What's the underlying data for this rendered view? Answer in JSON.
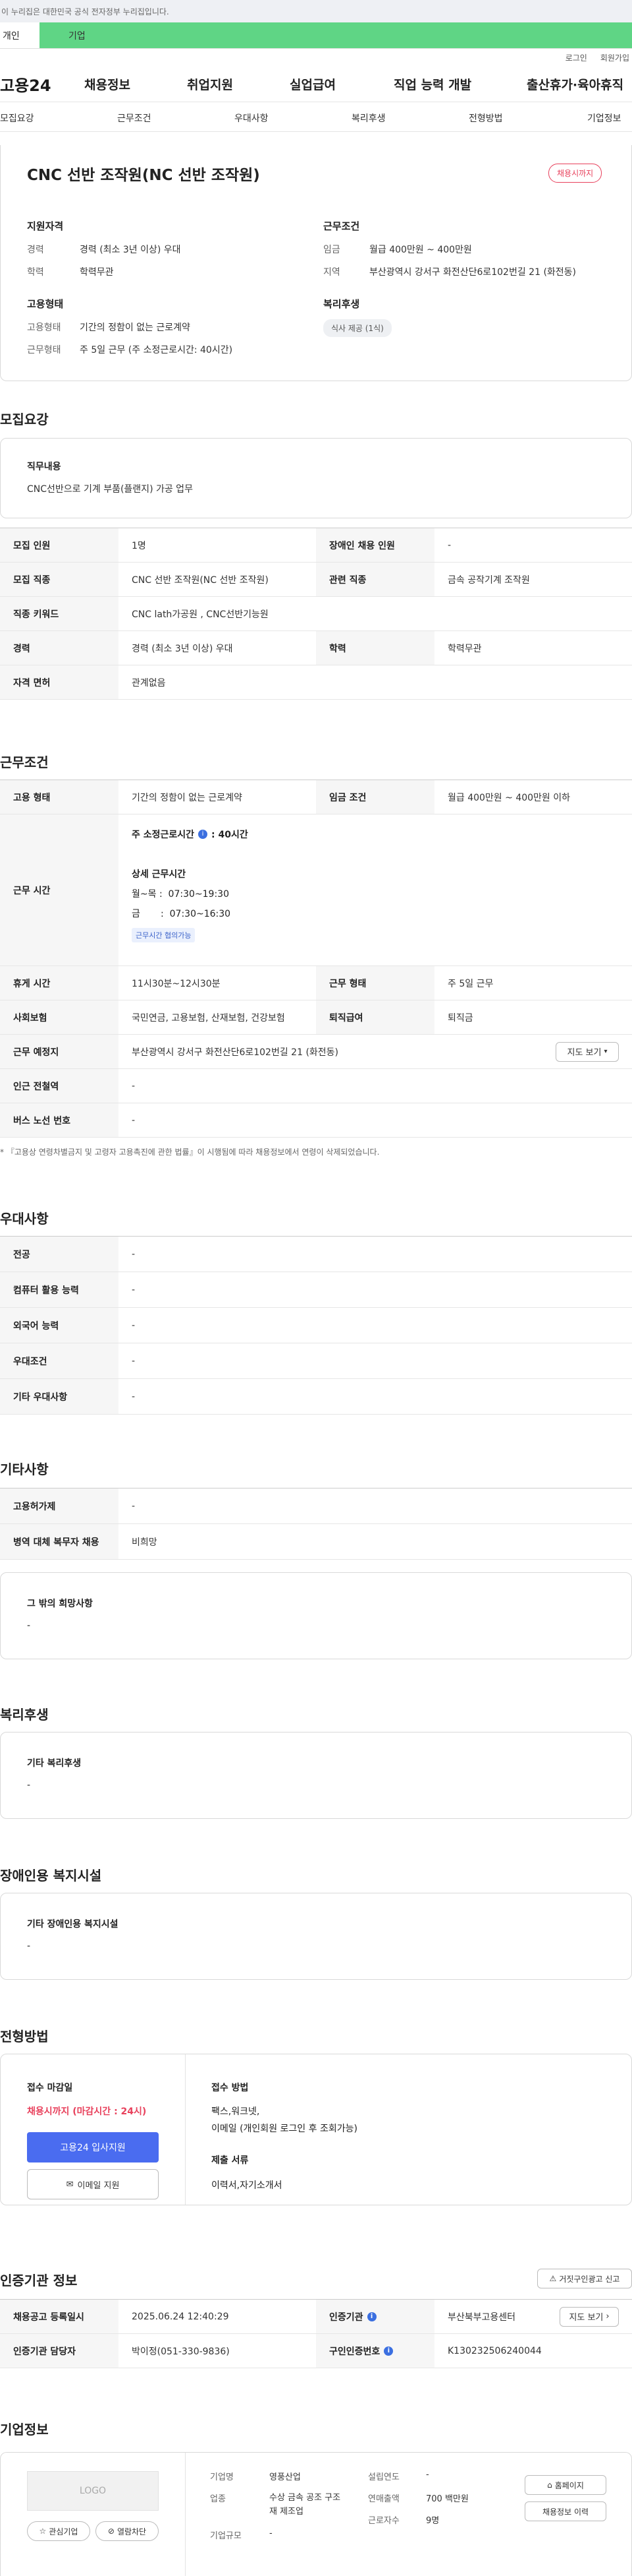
{
  "gov_notice": "이 누리집은 대한민국 공식 전자정부 누리집입니다.",
  "tabs": [
    "개인",
    "기업"
  ],
  "util": [
    "로그인",
    "회원가입"
  ],
  "logo": "고용24",
  "gnb": [
    "채용정보",
    "취업지원",
    "실업급여",
    "직업 능력 개발",
    "출산휴가·육아휴직"
  ],
  "subnav": [
    "모집요강",
    "근무조건",
    "우대사항",
    "복리후생",
    "전형방법",
    "기업정보"
  ],
  "summary": {
    "title": "CNC 선반 조작원(NC 선반 조작원)",
    "badge": "채용시까지",
    "qual_head": "지원자격",
    "cond_head": "근무조건",
    "emp_head": "고용형태",
    "welfare_head": "복리후생",
    "qual": [
      [
        "경력",
        "경력 (최소 3년 이상) 우대"
      ],
      [
        "학력",
        "학력무관"
      ]
    ],
    "cond": [
      [
        "임금",
        "월급 400만원 ~ 400만원"
      ],
      [
        "지역",
        "부산광역시 강서구 화전산단6로102번길 21 (화전동)"
      ]
    ],
    "emp": [
      [
        "고용형태",
        "기간의 정함이 없는 근로계약"
      ],
      [
        "근무형태",
        "주 5일 근무 (주 소정근로시간: 40시간)"
      ]
    ],
    "welfare_tag": "식사 제공 (1식)"
  },
  "s1": {
    "title": "모집요강",
    "duty_label": "직무내용",
    "duty": "CNC선반으로 기계 부품(플랜지) 가공 업무",
    "rows": [
      {
        "th1": "모집 인원",
        "td1": "1명",
        "th2": "장애인 채용 인원",
        "td2": "-"
      },
      {
        "th1": "모집 직종",
        "td1": "CNC 선반 조작원(NC 선반 조작원)",
        "th2": "관련 직종",
        "td2": "금속 공작기계 조작원"
      },
      {
        "th1": "직종 키워드",
        "td1": "CNC lath가공원 , CNC선반기능원"
      },
      {
        "th1": "경력",
        "td1": "경력 (최소 3년 이상) 우대",
        "th2": "학력",
        "td2": "학력무관"
      },
      {
        "th1": "자격 면허",
        "td1": "관계없음"
      }
    ]
  },
  "s2": {
    "title": "근무조건",
    "row1": {
      "th1": "고용 형태",
      "td1": "기간의 정함이 없는 근로계약",
      "th2": "임금 조건",
      "td2": "월급 400만원 ~ 400만원 이하"
    },
    "worktime": {
      "th": "근무 시간",
      "weekly": "주 소정근로시간",
      "weekly_val": ": 40시간",
      "detail": "상세 근무시간",
      "l1": "월~목 :  07:30~19:30",
      "l2": "금       :  07:30~16:30",
      "tag": "근무시간 협의가능"
    },
    "rows": [
      {
        "th1": "휴게 시간",
        "td1": "11시30분~12시30분",
        "th2": "근무 형태",
        "td2": "주 5일 근무"
      },
      {
        "th1": "사회보험",
        "td1": "국민연금, 고용보험, 산재보험, 건강보험",
        "th2": "퇴직급여",
        "td2": "퇴직금"
      }
    ],
    "place": {
      "th": "근무 예정지",
      "td": "부산광역시 강서구 화전산단6로102번길 21 (화전동)",
      "btn": "지도 보기"
    },
    "rows2": [
      {
        "th": "인근 전철역",
        "td": "-"
      },
      {
        "th": "버스 노선 번호",
        "td": "-"
      }
    ],
    "note": "* 『고용상 연령차별금지 및 고령자 고용촉진에 관한 법률』이 시행됨에 따라 채용정보에서 연령이 삭제되었습니다."
  },
  "s3": {
    "title": "우대사항",
    "rows": [
      [
        "전공",
        "-"
      ],
      [
        "컴퓨터 활용 능력",
        "-"
      ],
      [
        "외국어 능력",
        "-"
      ],
      [
        "우대조건",
        "-"
      ],
      [
        "기타 우대사항",
        "-"
      ]
    ]
  },
  "s4": {
    "title": "기타사항",
    "rows": [
      [
        "고용허가제",
        "-"
      ],
      [
        "병역 대체 복무자 채용",
        "비희망"
      ]
    ],
    "other_label": "그 밖의 희망사항",
    "other_val": "-"
  },
  "s5": {
    "title": "복리후생",
    "label": "기타 복리후생",
    "val": "-"
  },
  "s6": {
    "title": "장애인용 복지시설",
    "label": "기타 장애인용 복지시설",
    "val": "-"
  },
  "s7": {
    "title": "전형방법",
    "deadline_label": "접수 마감일",
    "deadline": "채용시까지 (마감시간 : 24시)",
    "apply_btn": "고용24 입사지원",
    "email_btn": "이메일 지원",
    "method_label": "접수 방법",
    "method": "팩스,워크넷,",
    "method2": "이메일 (개인회원 로그인 후 조회가능)",
    "docs_label": "제출 서류",
    "docs": "이력서,자기소개서"
  },
  "s8": {
    "title": "인증기관 정보",
    "report_btn": "거짓구인광고 신고",
    "rows": [
      {
        "th1": "채용공고 등록일시",
        "td1": "2025.06.24 12:40:29",
        "th2": "인증기관",
        "td2": "부산북부고용센터",
        "btn": "지도 보기"
      },
      {
        "th1": "인증기관 담당자",
        "td1": "박이정(051-330-9836)",
        "th2": "구인인증번호",
        "td2": "K130232506240044"
      }
    ]
  },
  "s9": {
    "title": "기업정보",
    "logo": "LOGO",
    "fav_btn": "관심기업",
    "block_btn": "열람차단",
    "info": [
      [
        "기업명",
        "영풍산업"
      ],
      [
        "업종",
        "수상 금속 공조 구조재 제조업"
      ],
      [
        "기업규모",
        "-"
      ]
    ],
    "info2": [
      [
        "설립연도",
        "-"
      ],
      [
        "연매출액",
        "700 백만원"
      ],
      [
        "근로자수",
        "9명"
      ]
    ],
    "home_btn": "홈페이지",
    "more_btn": "채용정보 이력"
  }
}
